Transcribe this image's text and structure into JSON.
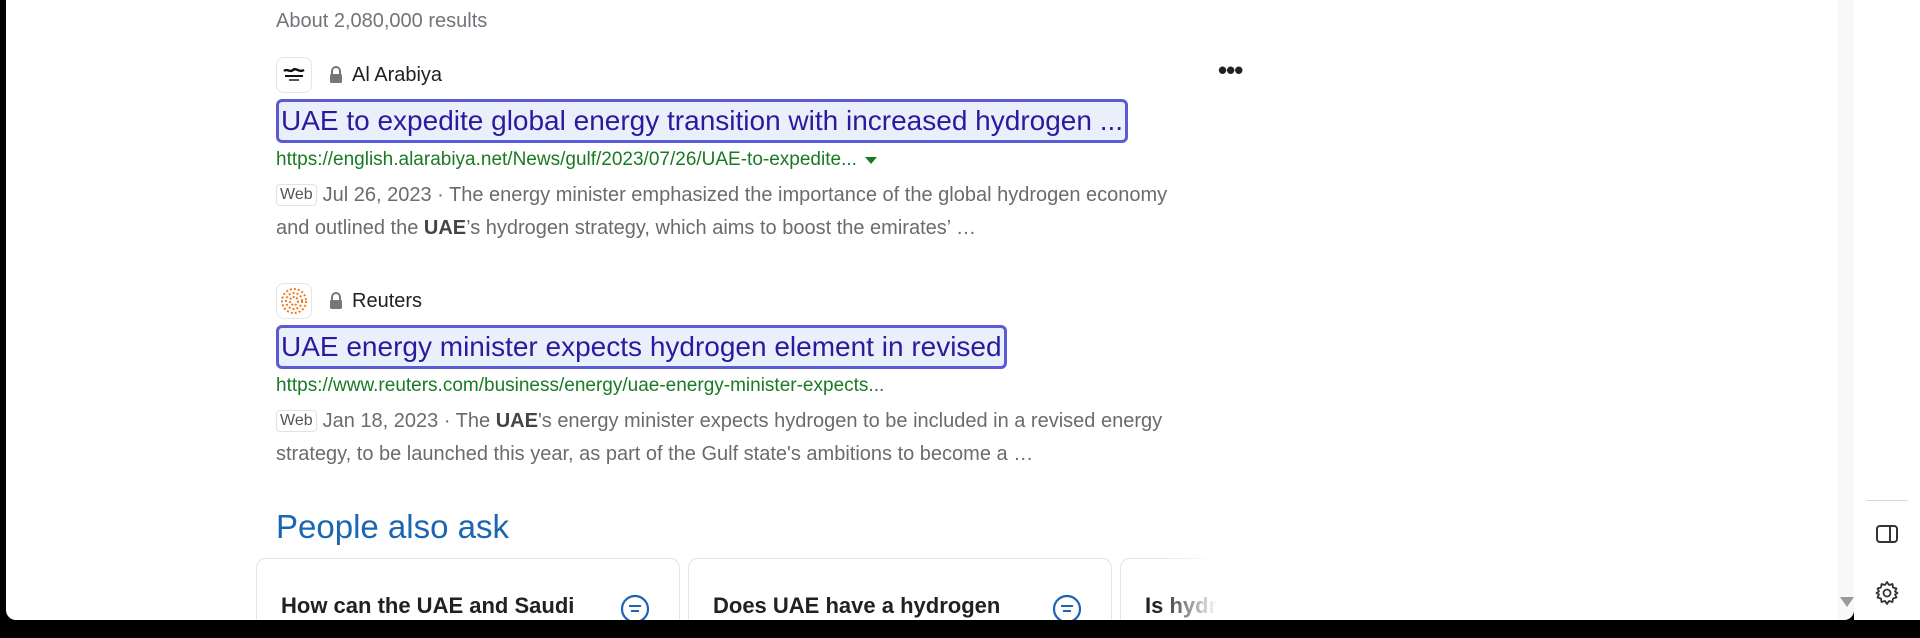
{
  "results_count": "About 2,080,000 results",
  "results": [
    {
      "source": "Al Arabiya",
      "title": "UAE to expedite global energy transition with increased hydrogen ...",
      "url": "https://english.alarabiya.net/News/gulf/2023/07/26/UAE-to-expedite...",
      "tag": "Web",
      "snippet_pre": "Jul 26, 2023 · The energy minister emphasized the importance of the global hydrogen economy and outlined the ",
      "snippet_bold": "UAE",
      "snippet_post": "’s hydrogen strategy, which aims to boost the emirates’ …"
    },
    {
      "source": "Reuters",
      "title": "UAE energy minister expects hydrogen element in revised",
      "url": "https://www.reuters.com/business/energy/uae-energy-minister-expects...",
      "tag": "Web",
      "snippet_pre": "Jan 18, 2023 · The ",
      "snippet_bold": "UAE",
      "snippet_post": "'s energy minister expects hydrogen to be included in a revised energy strategy, to be launched this year, as part of the Gulf state's ambitions to become a …"
    }
  ],
  "people_also_ask": {
    "title": "People also ask",
    "questions": [
      "How can the UAE and Saudi",
      "Does UAE have a hydrogen",
      "Is hydr"
    ]
  },
  "more_options_label": "•••",
  "icons": {
    "lock": "lock-icon",
    "more": "more-options-icon",
    "paa": "chat-bubble-icon",
    "side_panel": "side-panel-icon",
    "settings": "gear-icon"
  },
  "colors": {
    "link": "#2a1a9e",
    "url": "#1a7a23",
    "paa_title": "#1a66b3",
    "highlight_border": "#5b5bd6"
  }
}
